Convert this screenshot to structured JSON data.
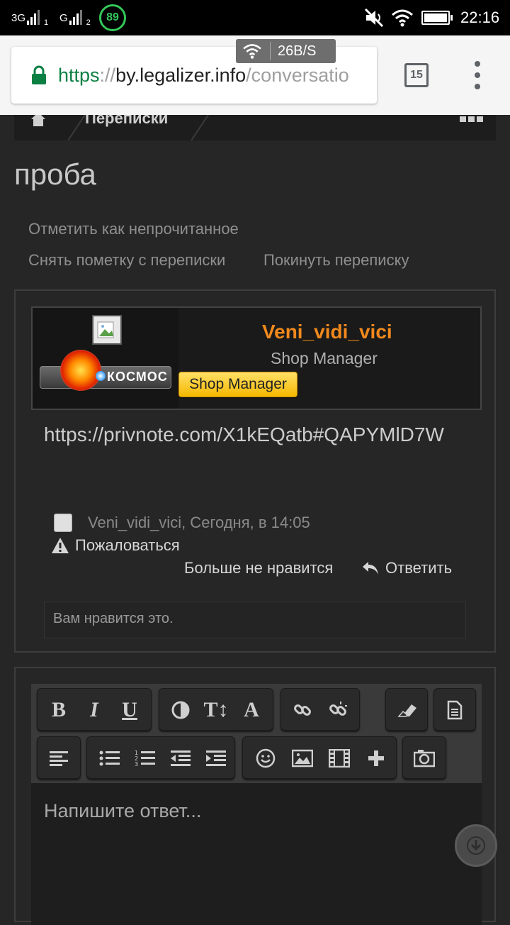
{
  "status_bar": {
    "network1": "3G",
    "network2": "G",
    "sim1": "1",
    "sim2": "2",
    "battery_badge": "89",
    "time": "22:16"
  },
  "browser": {
    "url_scheme": "https",
    "url_sep": "://",
    "url_host": "by.legalizer.info",
    "url_path": "/conversatio",
    "tab_count": "15",
    "speed": "26B/S"
  },
  "breadcrumb": {
    "label": "Переписки"
  },
  "page": {
    "title": "проба",
    "links": {
      "mark_unread": "Отметить как непрочитанное",
      "unstar": "Снять пометку с переписки",
      "leave": "Покинуть переписку"
    }
  },
  "message": {
    "avatar_badge": "КОСМОС",
    "username": "Veni_vidi_vici",
    "user_title": "Shop Manager",
    "banner": "Shop Manager",
    "body": "https://privnote.com/X1kEQatb#QAPYMlD7W",
    "meta": "Veni_vidi_vici, Сегодня, в 14:05",
    "report": "Пожаловаться",
    "unlike": "Больше не нравится",
    "reply": "Ответить",
    "likes": "Вам нравится это."
  },
  "editor": {
    "placeholder": "Напишите ответ..."
  },
  "colors": {
    "accent_username": "#f2891c",
    "banner": "#f5b800",
    "url_green": "#0b8043"
  }
}
